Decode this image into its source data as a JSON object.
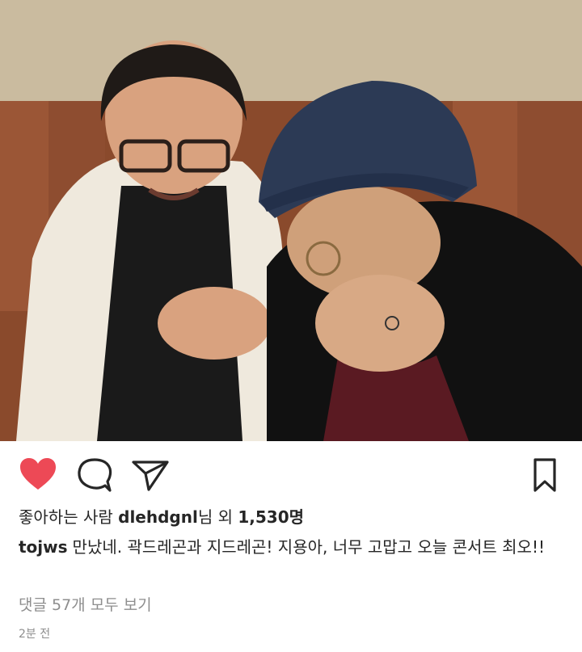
{
  "post": {
    "photo_alt": "post-photo",
    "likes": {
      "prefix": "좋아하는 사람 ",
      "liker": "dlehdgnl",
      "middle": "님 외 ",
      "count": "1,530",
      "suffix": "명"
    },
    "caption": {
      "username": "tojws",
      "text": "만났네. 곽드레곤과 지드레곤! 지용아, 너무 고맙고 오늘 콘서트 최오!!"
    },
    "view_comments": "댓글 57개 모두 보기",
    "timestamp": "2분 전"
  },
  "icons": {
    "like": "heart-filled-icon",
    "comment": "comment-bubble-icon",
    "share": "paper-plane-icon",
    "save": "bookmark-icon"
  },
  "colors": {
    "heart": "#ed4956",
    "text": "#262626",
    "muted": "#8e8e8e"
  }
}
